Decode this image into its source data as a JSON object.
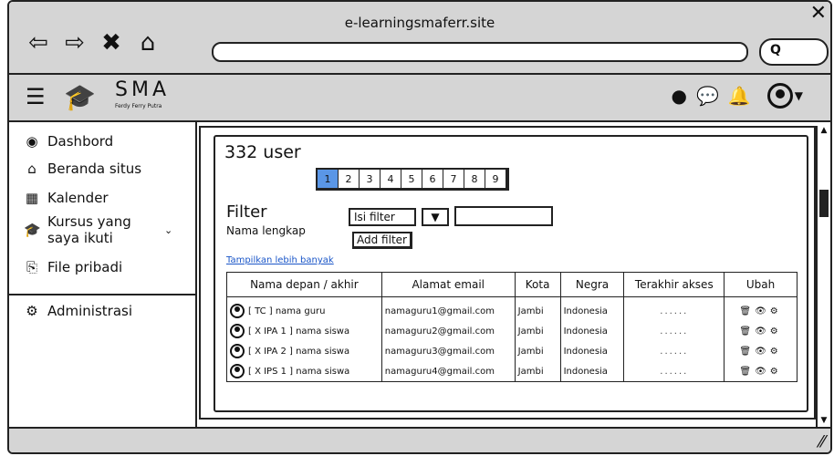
{
  "browser": {
    "site_title": "e-learningsmaferr.site",
    "nav_icons": [
      "back-icon",
      "forward-icon",
      "close-icon",
      "home-icon"
    ]
  },
  "header": {
    "logo_text": "SMA",
    "logo_sub": "Ferdy Ferry Putra",
    "icons": [
      "globe-icon",
      "chat-icon",
      "bell-icon",
      "user-avatar-icon"
    ]
  },
  "sidebar": {
    "items": [
      {
        "label": "Dashbord",
        "icon": "dashboard-icon"
      },
      {
        "label": "Beranda situs",
        "icon": "home-icon"
      },
      {
        "label": "Kalender",
        "icon": "calendar-icon"
      },
      {
        "label": "Kursus yang saya ikuti",
        "icon": "graduation-cap-icon"
      },
      {
        "label": "File pribadi",
        "icon": "file-icon"
      }
    ],
    "admin": {
      "label": "Administrasi",
      "icon": "gear-icon"
    }
  },
  "main": {
    "user_count": "332 user",
    "pages": [
      "1",
      "2",
      "3",
      "4",
      "5",
      "6",
      "7",
      "8",
      "9"
    ],
    "active_page": "1",
    "filter_title": "Filter",
    "filter_field_label": "Nama lengkap",
    "filter_select_value": "Isi filter",
    "filter_input_value": "",
    "add_filter_label": "Add filter",
    "show_more_label": "Tampilkan lebih banyak",
    "table": {
      "headers": [
        "Nama depan / akhir",
        "Alamat email",
        "Kota",
        "Negra",
        "Terakhir akses",
        "Ubah"
      ],
      "rows": [
        {
          "name": "[ TC ] nama guru",
          "email": "namaguru1@gmail.com",
          "city": "Jambi",
          "country": "Indonesia",
          "last_access": "......"
        },
        {
          "name": "[ X IPA 1 ] nama siswa",
          "email": "namaguru2@gmail.com",
          "city": "Jambi",
          "country": "Indonesia",
          "last_access": "......"
        },
        {
          "name": "[ X IPA 2 ] nama siswa",
          "email": "namaguru3@gmail.com",
          "city": "Jambi",
          "country": "Indonesia",
          "last_access": "......"
        },
        {
          "name": "[ X IPS 1 ] nama siswa",
          "email": "namaguru4@gmail.com",
          "city": "Jambi",
          "country": "Indonesia",
          "last_access": "......"
        }
      ]
    }
  }
}
